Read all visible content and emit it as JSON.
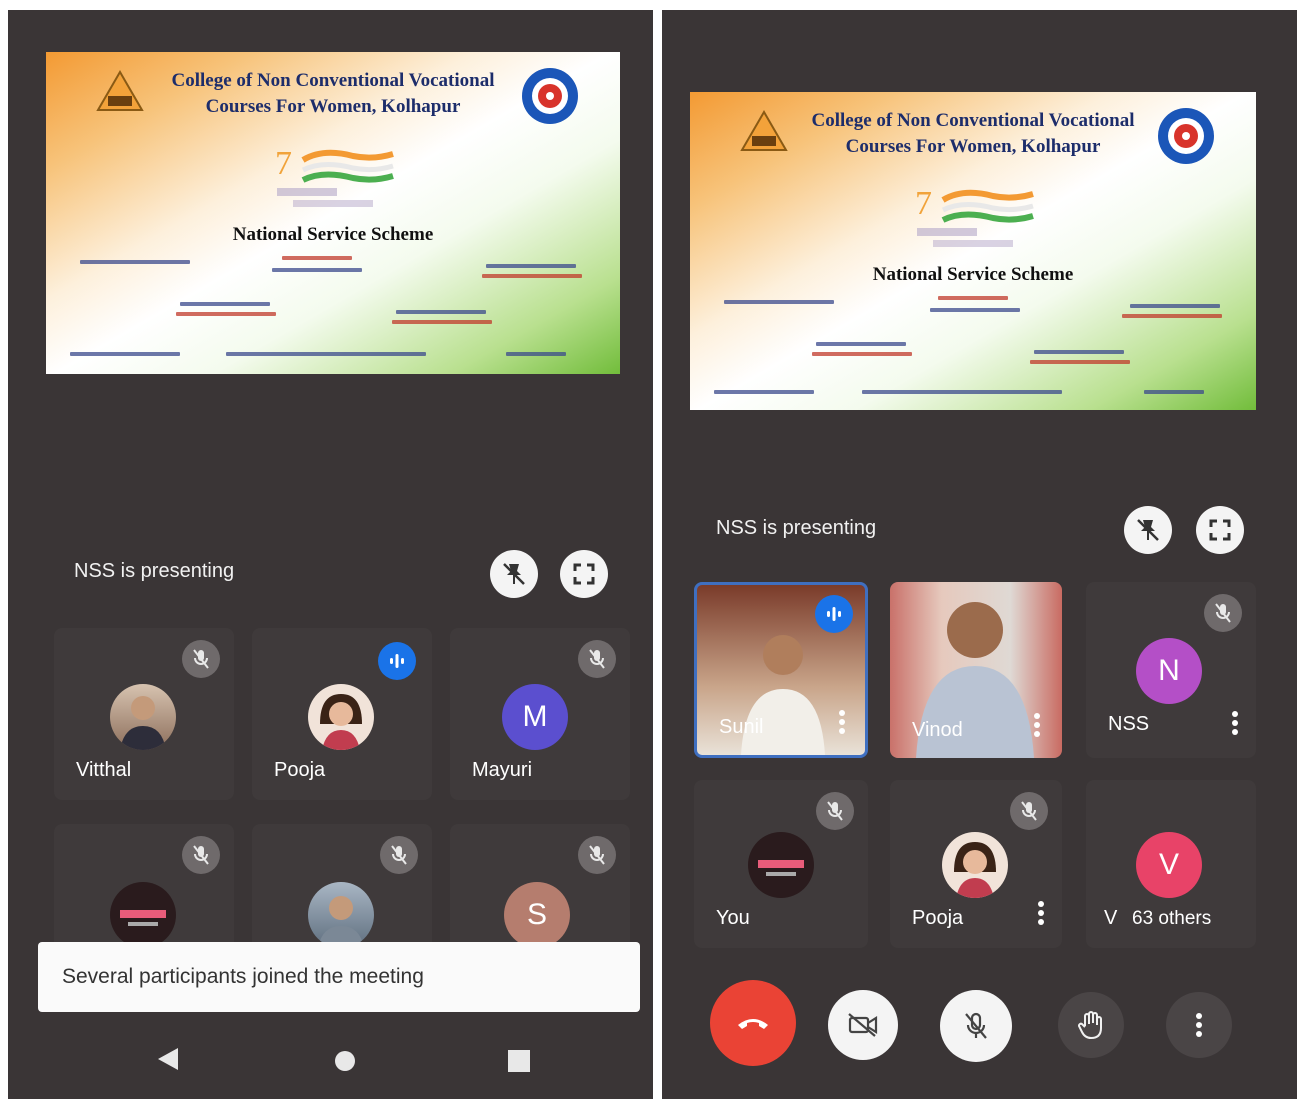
{
  "slide": {
    "title_line1": "College of Non Conventional Vocational",
    "title_line2": "Courses For Women, Kolhapur",
    "scheme": "National Service Scheme"
  },
  "left": {
    "presenting": "NSS is presenting",
    "participants": [
      {
        "name": "Vitthal",
        "state": "muted",
        "avatar": "photo"
      },
      {
        "name": "Pooja",
        "state": "speaking",
        "avatar": "photo"
      },
      {
        "name": "Mayuri",
        "state": "muted",
        "avatar": "letter",
        "initial": "M",
        "color": "#5b4fcf"
      },
      {
        "name": "",
        "state": "muted",
        "avatar": "logo"
      },
      {
        "name": "",
        "state": "muted",
        "avatar": "photo"
      },
      {
        "name": "",
        "state": "muted",
        "avatar": "letter",
        "initial": "S",
        "color": "#b57d6e"
      }
    ],
    "snackbar": "Several participants joined the meeting"
  },
  "right": {
    "presenting": "NSS is presenting",
    "participants": [
      {
        "name": "Sunil",
        "state": "speaking",
        "avatar": "video"
      },
      {
        "name": "Vinod",
        "state": "unmuted",
        "avatar": "video"
      },
      {
        "name": "NSS",
        "state": "muted",
        "avatar": "letter",
        "initial": "N",
        "color": "#b44fc7"
      },
      {
        "name": "You",
        "state": "muted",
        "avatar": "logo"
      },
      {
        "name": "Pooja",
        "state": "muted",
        "avatar": "photo"
      },
      {
        "name": "V",
        "state": "none",
        "avatar": "letter",
        "initial": "V",
        "color": "#e84368",
        "others": "63 others"
      }
    ]
  },
  "colors": {
    "end_call": "#ea4335",
    "speaking": "#1a73e8",
    "background": "#3a3536"
  },
  "icons": [
    "unpin-icon",
    "fullscreen-icon",
    "mic-off-icon",
    "speaking-icon",
    "more-icon",
    "end-call-icon",
    "camera-off-icon",
    "raise-hand-icon",
    "back-icon",
    "home-icon",
    "recents-icon"
  ]
}
